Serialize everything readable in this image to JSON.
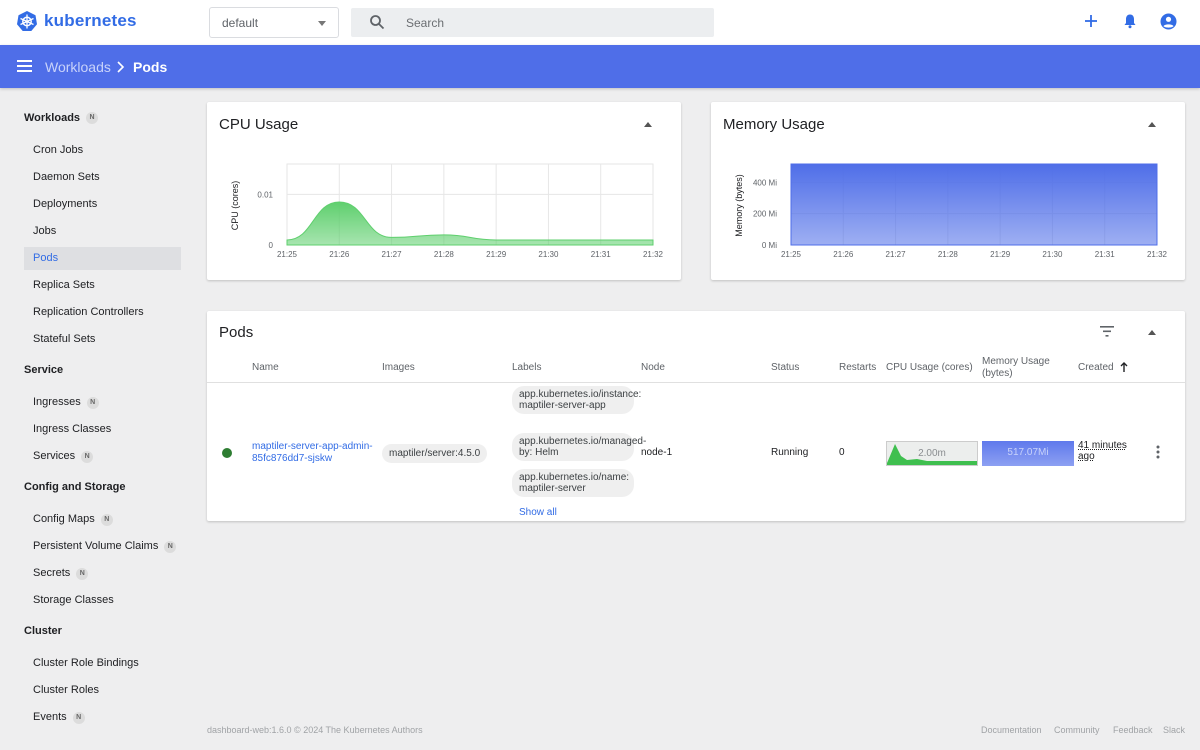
{
  "app": {
    "name": "kubernetes"
  },
  "header": {
    "namespace": "default",
    "search_placeholder": "Search"
  },
  "breadcrumb": {
    "parent": "Workloads",
    "separator": ">",
    "current": "Pods"
  },
  "sidebar": {
    "sections": [
      {
        "title": "Workloads",
        "badge": "N"
      },
      {
        "title": "Service"
      },
      {
        "title": "Config and Storage"
      },
      {
        "title": "Cluster"
      }
    ],
    "items": [
      {
        "label": "Cron Jobs"
      },
      {
        "label": "Daemon Sets"
      },
      {
        "label": "Deployments"
      },
      {
        "label": "Jobs"
      },
      {
        "label": "Pods",
        "active": true
      },
      {
        "label": "Replica Sets"
      },
      {
        "label": "Replication Controllers"
      },
      {
        "label": "Stateful Sets"
      },
      {
        "label": "Ingresses",
        "badge": "N"
      },
      {
        "label": "Ingress Classes"
      },
      {
        "label": "Services",
        "badge": "N"
      },
      {
        "label": "Config Maps",
        "badge": "N"
      },
      {
        "label": "Persistent Volume Claims",
        "badge": "N"
      },
      {
        "label": "Secrets",
        "badge": "N"
      },
      {
        "label": "Storage Classes"
      },
      {
        "label": "Cluster Role Bindings"
      },
      {
        "label": "Cluster Roles"
      },
      {
        "label": "Events",
        "badge": "N"
      }
    ]
  },
  "cpu_card": {
    "title": "CPU Usage"
  },
  "memory_card": {
    "title": "Memory Usage"
  },
  "chart_data": [
    {
      "type": "area",
      "ylabel": "CPU (cores)",
      "x": [
        "21:25",
        "21:26",
        "21:27",
        "21:28",
        "21:29",
        "21:30",
        "21:31",
        "21:32"
      ],
      "y_ticks": [
        "0",
        "0.01"
      ],
      "ylim": [
        0,
        0.016
      ],
      "values": [
        0.001,
        0.0085,
        0.0015,
        0.002,
        0.001,
        0.001,
        0.001,
        0.001
      ],
      "color": "#5fcf6e"
    },
    {
      "type": "area",
      "ylabel": "Memory (bytes)",
      "x": [
        "21:25",
        "21:26",
        "21:27",
        "21:28",
        "21:29",
        "21:30",
        "21:31",
        "21:32"
      ],
      "y_ticks": [
        "0 Mi",
        "200 Mi",
        "400 Mi"
      ],
      "ylim": [
        0,
        517
      ],
      "values": [
        517,
        517,
        517,
        517,
        517,
        517,
        517,
        517
      ],
      "color": "#4f6ee8"
    }
  ],
  "pods_card": {
    "title": "Pods",
    "columns": [
      "Name",
      "Images",
      "Labels",
      "Node",
      "Status",
      "Restarts",
      "CPU Usage (cores)",
      "Memory Usage (bytes)",
      "Created"
    ],
    "row": {
      "name": "maptiler-server-app-admin-85fc876dd7-sjskw",
      "image": "maptiler/server:4.5.0",
      "labels": [
        "app.kubernetes.io/instance: maptiler-server-app",
        "app.kubernetes.io/managed-by: Helm",
        "app.kubernetes.io/name: maptiler-server"
      ],
      "show_all": "Show all",
      "node": "node-1",
      "status": "Running",
      "restarts": "0",
      "cpu": "2.00m",
      "memory": "517.07Mi",
      "created": "41 minutes ago"
    }
  },
  "footer": {
    "version": "dashboard-web:1.6.0 © 2024 The Kubernetes Authors",
    "links": [
      "Documentation",
      "Community",
      "Feedback",
      "Slack"
    ]
  }
}
